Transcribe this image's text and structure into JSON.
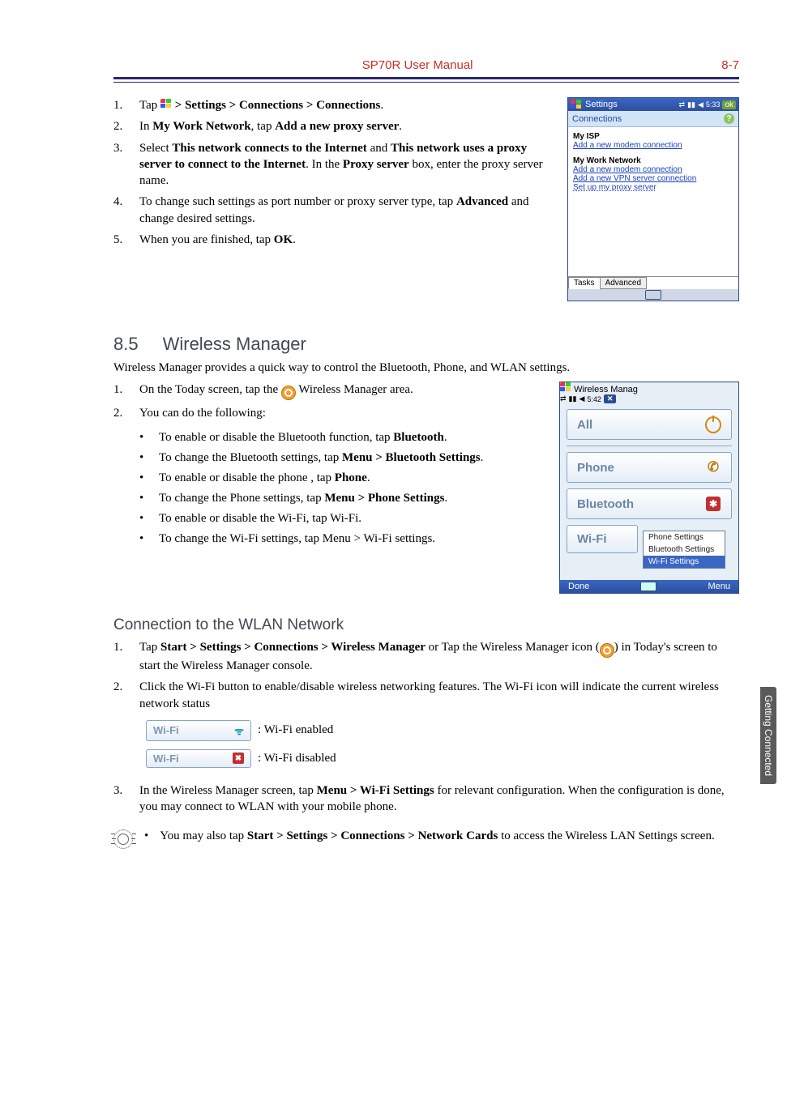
{
  "header": {
    "title": "SP70R User Manual",
    "page": "8-7"
  },
  "sidetab": "Getting Connected",
  "proxy": {
    "step1": {
      "n": "1.",
      "pre": "Tap ",
      "path": " > Settings > Connections > Connections",
      "post": "."
    },
    "step2": {
      "n": "2.",
      "pre": "In ",
      "b1": "My Work Network",
      "mid": ", tap ",
      "b2": "Add a new proxy server",
      "post": "."
    },
    "step3": {
      "n": "3.",
      "pre": "Select ",
      "b1": "This network connects to the Internet",
      "mid": " and ",
      "b2": "This network uses a proxy server to connect to the Internet",
      "post1": ". In the ",
      "b3": "Proxy server",
      "post2": " box, enter the proxy server name."
    },
    "step4": {
      "n": "4.",
      "pre": "To change such settings as port number or proxy server type, tap ",
      "b1": "Advanced",
      "post": " and change desired settings."
    },
    "step5": {
      "n": "5.",
      "pre": "When you are finished, tap ",
      "b1": "OK",
      "post": "."
    }
  },
  "shot1": {
    "title": "Settings",
    "time": "5:33",
    "ok": "ok",
    "subhead": "Connections",
    "isp_title": "My ISP",
    "isp_link1": "Add a new modem connection",
    "work_title": "My Work Network",
    "work_link1": "Add a new modem connection",
    "work_link2": "Add a new VPN server connection",
    "work_link3": "Set up my proxy server",
    "tab_tasks": "Tasks",
    "tab_adv": "Advanced"
  },
  "sec85": {
    "num": "8.5",
    "title": "Wireless Manager",
    "intro": "Wireless Manager provides a quick way to control the Bluetooth, Phone, and WLAN settings.",
    "step1": {
      "n": "1.",
      "pre": "On the Today screen, tap the ",
      "post": " Wireless Manager area."
    },
    "step2": {
      "n": "2.",
      "text": "You can do the following:"
    },
    "bul": {
      "b1": {
        "pre": "To enable or disable the Bluetooth function, tap ",
        "b": "Bluetooth",
        "post": "."
      },
      "b2": {
        "pre": "To change the Bluetooth settings, tap ",
        "b": "Menu > Bluetooth Settings",
        "post": "."
      },
      "b3": {
        "pre": "To enable or disable the phone , tap ",
        "b": "Phone",
        "post": "."
      },
      "b4": {
        "pre": "To change the Phone settings, tap ",
        "b": "Menu > Phone Settings",
        "post": "."
      },
      "b5": "To enable or disable the Wi-Fi, tap Wi-Fi.",
      "b6": "To change the Wi-Fi settings, tap Menu > Wi-Fi settings."
    }
  },
  "shot2": {
    "title": "Wireless Manag",
    "time": "5:42",
    "rows": {
      "all": "All",
      "phone": "Phone",
      "bt": "Bluetooth",
      "wifi": "Wi-Fi"
    },
    "menu": {
      "m1": "Phone Settings",
      "m2": "Bluetooth Settings",
      "m3": "Wi-Fi Settings"
    },
    "soft": {
      "left": "Done",
      "right": "Menu"
    }
  },
  "wlan": {
    "title": "Connection to the WLAN Network",
    "step1": {
      "n": "1.",
      "pre": "Tap ",
      "b": "Start > Settings > Connections > Wireless Manager",
      "mid": " or Tap the Wireless Manager icon (",
      "post": ") in Today's screen to start the Wireless Manager console."
    },
    "step2": {
      "n": "2.",
      "text": "Click the Wi-Fi button to enable/disable wireless networking features. The Wi-Fi icon will indicate the current wireless network status"
    },
    "wifi_label": "Wi-Fi",
    "enabled": " : Wi-Fi enabled",
    "disabled": " : Wi-Fi disabled",
    "step3": {
      "n": "3.",
      "pre": "In the Wireless Manager screen, tap ",
      "b": "Menu > Wi-Fi Settings",
      "post": " for relevant configuration. When the configuration is done, you may connect to WLAN with your mobile phone."
    }
  },
  "tip": {
    "dot": "•",
    "pre": "You may also tap ",
    "b": "Start > Settings > Connections > Network Cards",
    "post": " to access the Wireless LAN Settings screen."
  }
}
